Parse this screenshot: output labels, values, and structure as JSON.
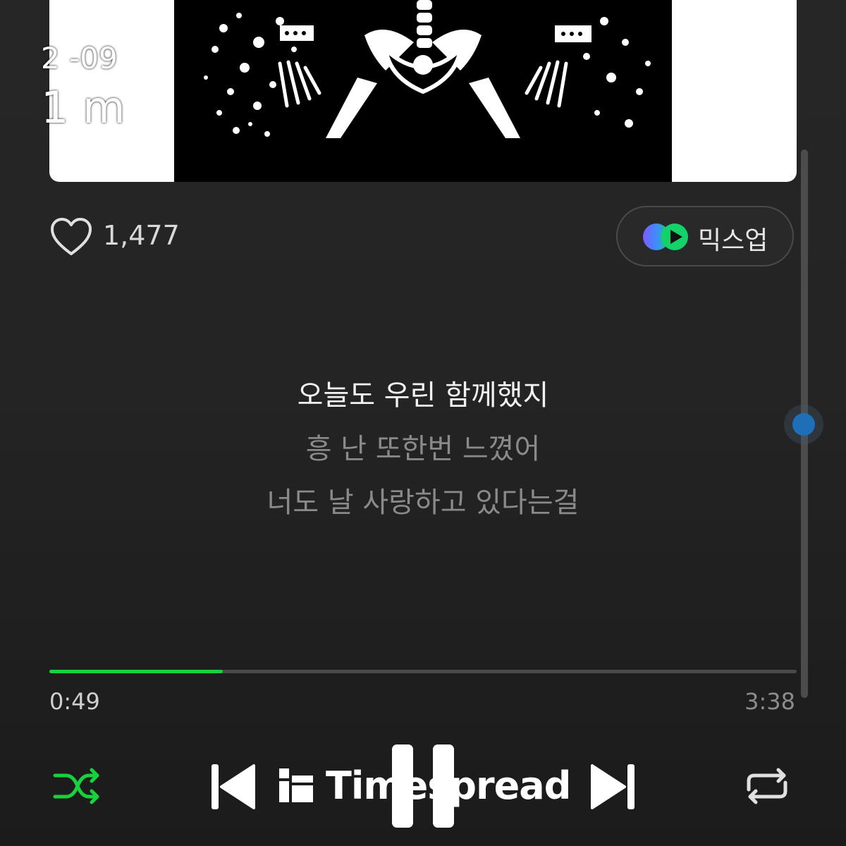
{
  "overlay": {
    "date": "2   -09",
    "time": "1      m"
  },
  "like": {
    "count": "1,477",
    "icon": "heart-icon"
  },
  "mixup": {
    "label": "믹스업",
    "icon": "mixup-logo-icon"
  },
  "lyrics": {
    "active": "오늘도 우린 함께했지",
    "next_1": "흥 난 또한번 느꼈어",
    "next_2": "너도 날 사랑하고 있다는걸"
  },
  "playback": {
    "current_time": "0:49",
    "total_time": "3:38",
    "progress": 0.232,
    "accent_color": "#18d23d"
  },
  "controls": {
    "shuffle": "shuffle-icon",
    "previous": "skip-previous-icon",
    "pause": "pause-icon",
    "next": "skip-next-icon",
    "repeat": "repeat-icon"
  },
  "watermark": {
    "text": "Timespread"
  },
  "scroll_indicator_color": "#1f6fb8"
}
